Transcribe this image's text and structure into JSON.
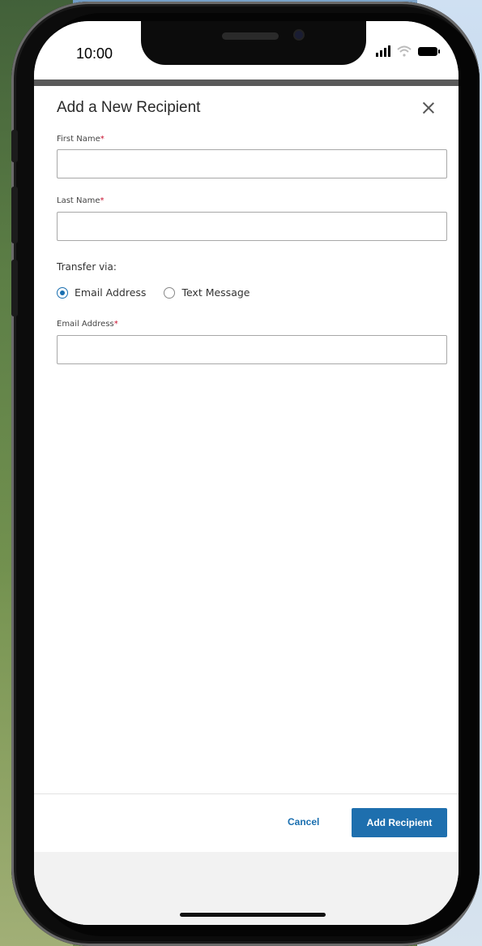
{
  "status_bar": {
    "time": "10:00"
  },
  "modal": {
    "title": "Add a New Recipient",
    "first_name": {
      "label": "First Name",
      "required_mark": "*",
      "value": "",
      "placeholder": ""
    },
    "last_name": {
      "label": "Last Name",
      "required_mark": "*",
      "value": "",
      "placeholder": ""
    },
    "transfer_via": {
      "label": "Transfer via:",
      "options": [
        {
          "label": "Email Address",
          "selected": true
        },
        {
          "label": "Text Message",
          "selected": false
        }
      ]
    },
    "email": {
      "label": "Email Address",
      "required_mark": "*",
      "value": "",
      "placeholder": ""
    },
    "footer": {
      "cancel_label": "Cancel",
      "submit_label": "Add Recipient"
    }
  },
  "colors": {
    "accent": "#1e6fae",
    "required": "#c8102e"
  }
}
